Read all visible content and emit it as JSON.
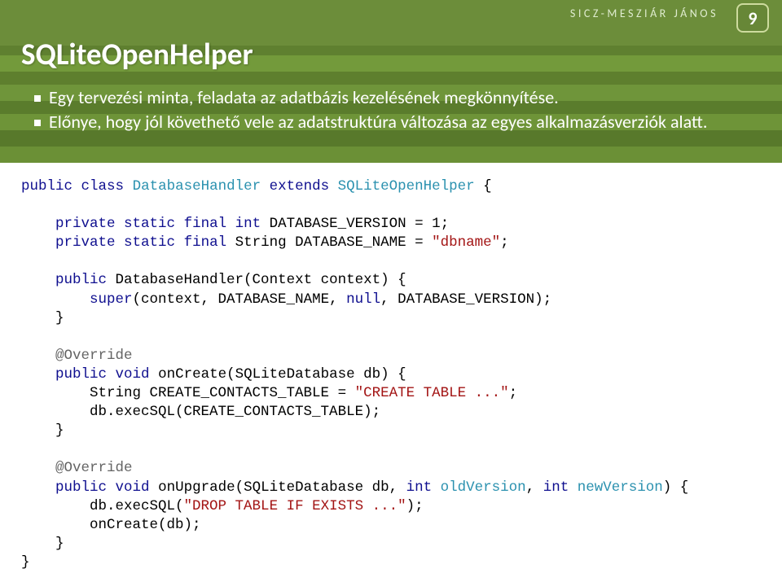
{
  "author": "SICZ-MESZIÁR JÁNOS",
  "page_number": "9",
  "title": "SQLiteOpenHelper",
  "bullets": [
    "Egy tervezési minta, feladata az adatbázis kezelésének megkönnyítése.",
    "Előnye, hogy jól követhető vele az adatstruktúra változása az egyes alkalmazásverziók alatt."
  ],
  "code": {
    "l1_a": "public",
    "l1_b": " ",
    "l1_c": "class",
    "l1_d": " ",
    "l1_e": "DatabaseHandler",
    "l1_f": " ",
    "l1_g": "extends",
    "l1_h": " ",
    "l1_i": "SQLiteOpenHelper",
    "l1_j": " {",
    "l2_a": "    private",
    "l2_b": " ",
    "l2_c": "static",
    "l2_d": " ",
    "l2_e": "final",
    "l2_f": " ",
    "l2_g": "int",
    "l2_h": " DATABASE_VERSION = 1;",
    "l3_a": "    private",
    "l3_b": " ",
    "l3_c": "static",
    "l3_d": " ",
    "l3_e": "final",
    "l3_f": " String DATABASE_NAME = ",
    "l3_g": "\"dbname\"",
    "l3_h": ";",
    "l4_a": "    public",
    "l4_b": " DatabaseHandler(Context context) {",
    "l5_a": "        super",
    "l5_b": "(context, DATABASE_NAME, ",
    "l5_c": "null",
    "l5_d": ", DATABASE_VERSION);",
    "l6": "    }",
    "l7": "    @Override",
    "l8_a": "    public",
    "l8_b": " ",
    "l8_c": "void",
    "l8_d": " onCreate(SQLiteDatabase db) {",
    "l9_a": "        String CREATE_CONTACTS_TABLE = ",
    "l9_b": "\"CREATE TABLE ...\"",
    "l9_c": ";",
    "l10": "        db.execSQL(CREATE_CONTACTS_TABLE);",
    "l11": "    }",
    "l12": "    @Override",
    "l13_a": "    public",
    "l13_b": " ",
    "l13_c": "void",
    "l13_d": " onUpgrade(SQLiteDatabase db, ",
    "l13_e": "int",
    "l13_f": " ",
    "l13_g": "oldVersion",
    "l13_h": ", ",
    "l13_i": "int",
    "l13_j": " ",
    "l13_k": "newVersion",
    "l13_l": ") {",
    "l14_a": "        db.execSQL(",
    "l14_b": "\"DROP TABLE IF EXISTS ...\"",
    "l14_c": ");",
    "l15": "        onCreate(db);",
    "l16": "    }",
    "l17": "}"
  }
}
